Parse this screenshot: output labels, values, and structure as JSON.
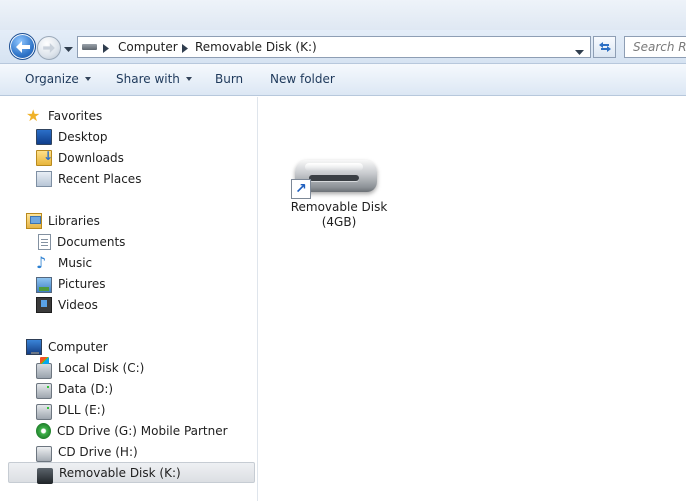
{
  "address": {
    "crumbs": [
      "Computer",
      "Removable Disk (K:)"
    ]
  },
  "search": {
    "placeholder": "Search Rem"
  },
  "toolbar": {
    "organize": "Organize",
    "share_with": "Share with",
    "burn": "Burn",
    "new_folder": "New folder"
  },
  "nav": {
    "favorites": {
      "label": "Favorites",
      "items": [
        "Desktop",
        "Downloads",
        "Recent Places"
      ]
    },
    "libraries": {
      "label": "Libraries",
      "items": [
        "Documents",
        "Music",
        "Pictures",
        "Videos"
      ]
    },
    "computer": {
      "label": "Computer",
      "items": [
        "Local Disk (C:)",
        "Data (D:)",
        "DLL (E:)",
        "CD Drive (G:) Mobile Partner",
        "CD Drive (H:)",
        "Removable Disk (K:)"
      ]
    }
  },
  "content": {
    "items": [
      {
        "label": "Removable Disk",
        "sublabel": "(4GB)",
        "icon": "removable-disk-shortcut-icon"
      }
    ]
  }
}
